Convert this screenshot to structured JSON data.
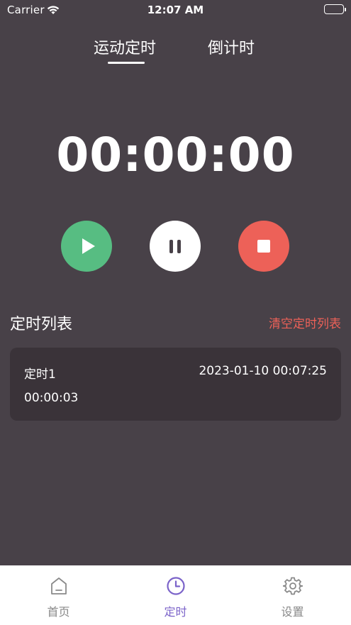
{
  "status_bar": {
    "carrier": "Carrier",
    "time": "12:07 AM"
  },
  "tabs": [
    {
      "label": "运动定时",
      "active": true
    },
    {
      "label": "倒计时",
      "active": false
    }
  ],
  "timer": {
    "display": "00:00:00"
  },
  "controls": [
    {
      "name": "play",
      "icon": "play-icon",
      "color": "#57bd82"
    },
    {
      "name": "pause",
      "icon": "pause-icon",
      "color": "#ffffff"
    },
    {
      "name": "stop",
      "icon": "stop-icon",
      "color": "#ed6158"
    }
  ],
  "list": {
    "title": "定时列表",
    "clear_label": "清空定时列表",
    "records": [
      {
        "name": "定时1",
        "datetime": "2023-01-10 00:07:25",
        "duration": "00:00:03"
      }
    ]
  },
  "tab_bar": {
    "items": [
      {
        "label": "首页",
        "icon": "home-icon",
        "active": false
      },
      {
        "label": "定时",
        "icon": "clock-icon",
        "active": true
      },
      {
        "label": "设置",
        "icon": "gear-icon",
        "active": false
      }
    ]
  },
  "colors": {
    "background": "#484148",
    "card": "#3a3339",
    "accent_green": "#57bd82",
    "accent_red": "#ed6158",
    "tab_active": "#7b63c9",
    "tab_inactive": "#888888"
  }
}
